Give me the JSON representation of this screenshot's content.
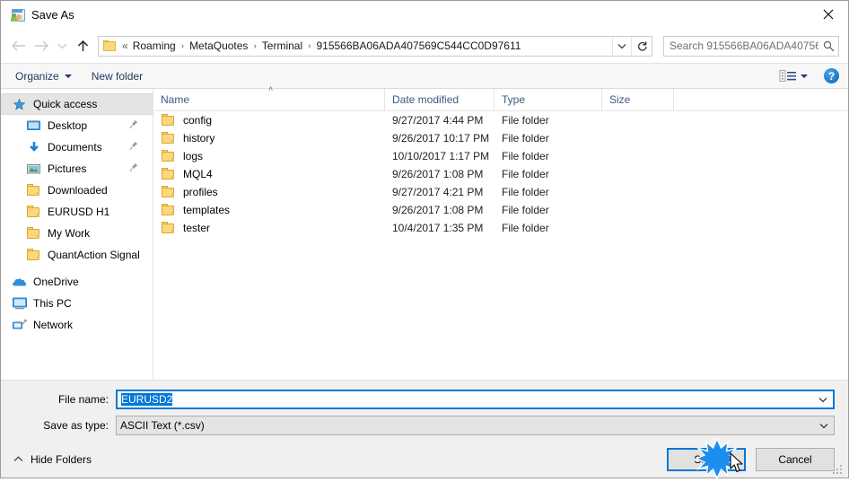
{
  "window": {
    "title": "Save As",
    "title_icon": "save-as-app-icon",
    "close_icon": "close-icon"
  },
  "nav": {
    "back_icon": "arrow-left-icon",
    "forward_icon": "arrow-right-icon",
    "recent_icon": "chevron-down-icon",
    "up_icon": "arrow-up-icon",
    "address": {
      "folder_icon": "folder-icon",
      "ellipsis": "«",
      "crumbs": [
        "Roaming",
        "MetaQuotes",
        "Terminal",
        "915566BA06ADA407569C544CC0D97611"
      ],
      "separator": "›",
      "dropdown_icon": "chevron-down-icon",
      "refresh_icon": "refresh-icon"
    },
    "search": {
      "placeholder": "Search 915566BA06ADA40756...",
      "icon": "search-icon"
    }
  },
  "toolbar": {
    "organize_label": "Organize",
    "new_folder_label": "New folder",
    "view_icon": "list-view-icon",
    "help_label": "?",
    "help_icon": "help-icon"
  },
  "sidebar": {
    "items": [
      {
        "label": "Quick access",
        "icon": "star-icon",
        "selected": true,
        "indent": false,
        "pinned": false
      },
      {
        "label": "Desktop",
        "icon": "desktop-icon",
        "selected": false,
        "indent": true,
        "pinned": true
      },
      {
        "label": "Documents",
        "icon": "documents-download-icon",
        "selected": false,
        "indent": true,
        "pinned": true
      },
      {
        "label": "Pictures",
        "icon": "pictures-icon",
        "selected": false,
        "indent": true,
        "pinned": true
      },
      {
        "label": "Downloaded",
        "icon": "folder-icon",
        "selected": false,
        "indent": true,
        "pinned": false
      },
      {
        "label": "EURUSD H1",
        "icon": "folder-icon",
        "selected": false,
        "indent": true,
        "pinned": false
      },
      {
        "label": "My Work",
        "icon": "folder-icon",
        "selected": false,
        "indent": true,
        "pinned": false
      },
      {
        "label": "QuantAction Signal",
        "icon": "folder-icon",
        "selected": false,
        "indent": true,
        "pinned": false
      },
      {
        "label": "OneDrive",
        "icon": "onedrive-cloud-icon",
        "selected": false,
        "indent": false,
        "pinned": false
      },
      {
        "label": "This PC",
        "icon": "this-pc-icon",
        "selected": false,
        "indent": false,
        "pinned": false
      },
      {
        "label": "Network",
        "icon": "network-icon",
        "selected": false,
        "indent": false,
        "pinned": false
      }
    ]
  },
  "filelist": {
    "columns": [
      "Name",
      "Date modified",
      "Type",
      "Size"
    ],
    "sort_indicator": "˄",
    "rows": [
      {
        "name": "config",
        "date": "9/27/2017 4:44 PM",
        "type": "File folder",
        "size": ""
      },
      {
        "name": "history",
        "date": "9/26/2017 10:17 PM",
        "type": "File folder",
        "size": ""
      },
      {
        "name": "logs",
        "date": "10/10/2017 1:17 PM",
        "type": "File folder",
        "size": ""
      },
      {
        "name": "MQL4",
        "date": "9/26/2017 1:08 PM",
        "type": "File folder",
        "size": ""
      },
      {
        "name": "profiles",
        "date": "9/27/2017 4:21 PM",
        "type": "File folder",
        "size": ""
      },
      {
        "name": "templates",
        "date": "9/26/2017 1:08 PM",
        "type": "File folder",
        "size": ""
      },
      {
        "name": "tester",
        "date": "10/4/2017 1:35 PM",
        "type": "File folder",
        "size": ""
      }
    ]
  },
  "form": {
    "filename_label": "File name:",
    "filename_value": "EURUSD2",
    "filetype_label": "Save as type:",
    "filetype_value": "ASCII Text (*.csv)",
    "dropdown_icon": "chevron-down-icon"
  },
  "footer": {
    "hide_folders_label": "Hide Folders",
    "hide_folders_icon": "chevron-up-icon",
    "save_label": "Save",
    "cancel_label": "Cancel",
    "resize_grip": "resize-grip-icon"
  },
  "overlay": {
    "click_effect": "click-starburst",
    "cursor": "mouse-cursor"
  },
  "colors": {
    "accent": "#0078d7",
    "folder": "#fcd77f",
    "header_text": "#3c5a82",
    "selection": "#e4e4e4"
  }
}
